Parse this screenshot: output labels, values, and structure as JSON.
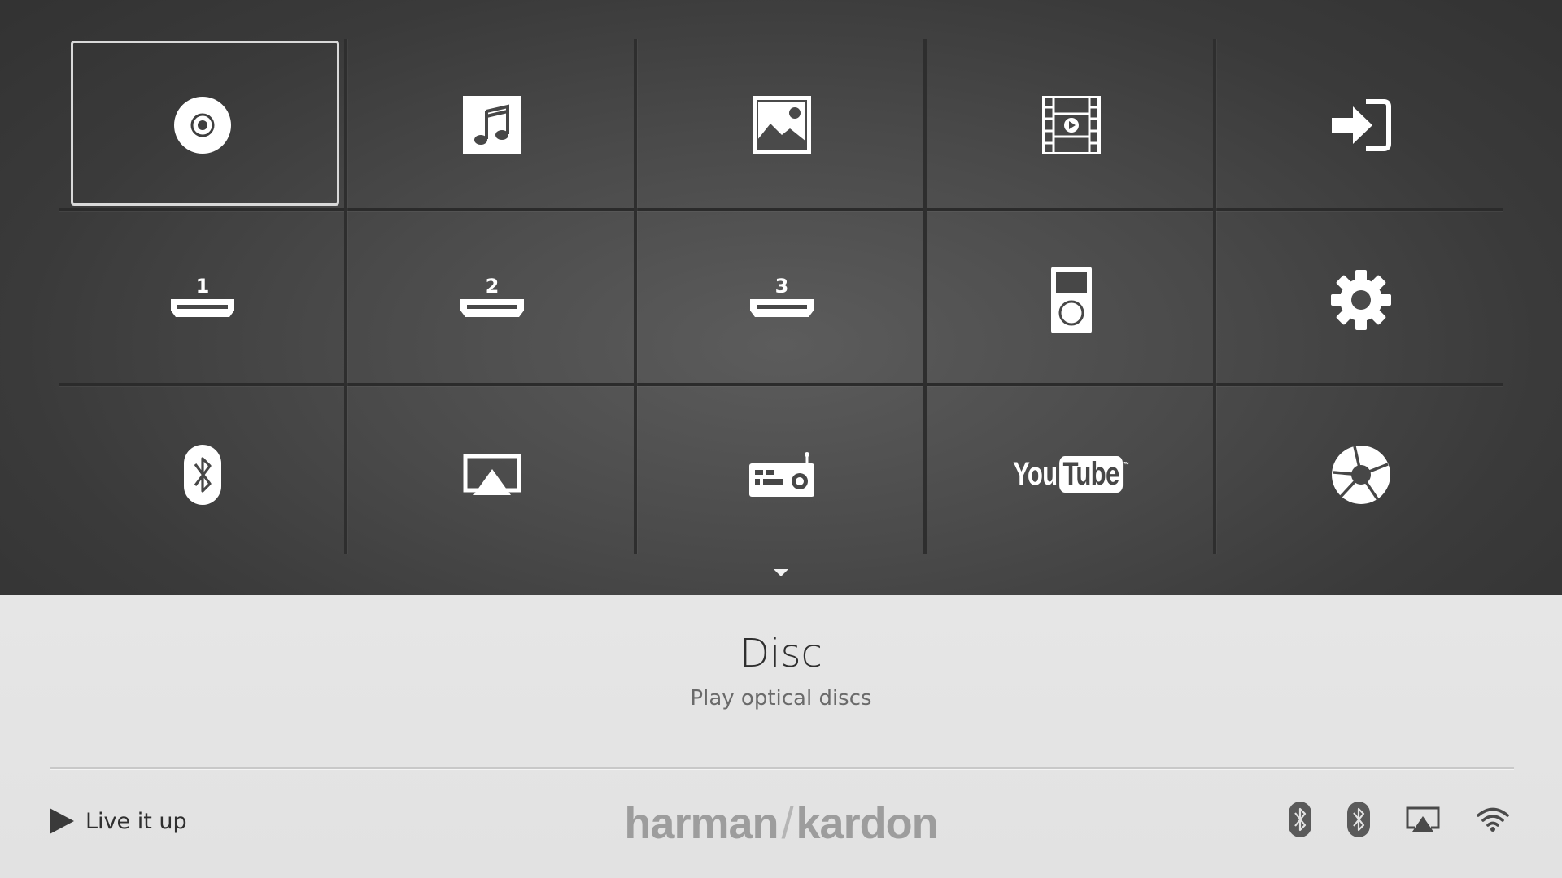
{
  "menu": {
    "tiles": [
      {
        "icon": "disc-icon",
        "id": "disc",
        "selected": true
      },
      {
        "icon": "music-note-icon",
        "id": "music"
      },
      {
        "icon": "photo-icon",
        "id": "photos"
      },
      {
        "icon": "film-icon",
        "id": "videos"
      },
      {
        "icon": "input-arrow-icon",
        "id": "input"
      },
      {
        "icon": "hdmi-port-icon",
        "id": "hdmi-1",
        "label": "1"
      },
      {
        "icon": "hdmi-port-icon",
        "id": "hdmi-2",
        "label": "2"
      },
      {
        "icon": "hdmi-port-icon",
        "id": "hdmi-3",
        "label": "3"
      },
      {
        "icon": "ipod-icon",
        "id": "ipod"
      },
      {
        "icon": "gear-icon",
        "id": "settings"
      },
      {
        "icon": "bluetooth-icon",
        "id": "bluetooth"
      },
      {
        "icon": "airplay-icon",
        "id": "airplay"
      },
      {
        "icon": "radio-icon",
        "id": "radio"
      },
      {
        "icon": "youtube-logo-icon",
        "id": "youtube",
        "logo_text_a": "You",
        "logo_text_b": "Tube",
        "logo_mark": "™"
      },
      {
        "icon": "picasa-logo-icon",
        "id": "picasa"
      }
    ]
  },
  "selected_item": {
    "title": "Disc",
    "description": "Play optical discs"
  },
  "footer": {
    "tagline": "Live it up",
    "brand_left": "harman",
    "brand_slash": "/",
    "brand_right": "kardon",
    "status_icons": [
      "bluetooth-icon",
      "bluetooth-icon",
      "airplay-icon",
      "wifi-icon"
    ]
  },
  "colors": {
    "panel_dark": "#3a3a3a",
    "panel_light": "#e4e4e4",
    "icon": "#ffffff",
    "selection_border": "#d9d9d9"
  }
}
